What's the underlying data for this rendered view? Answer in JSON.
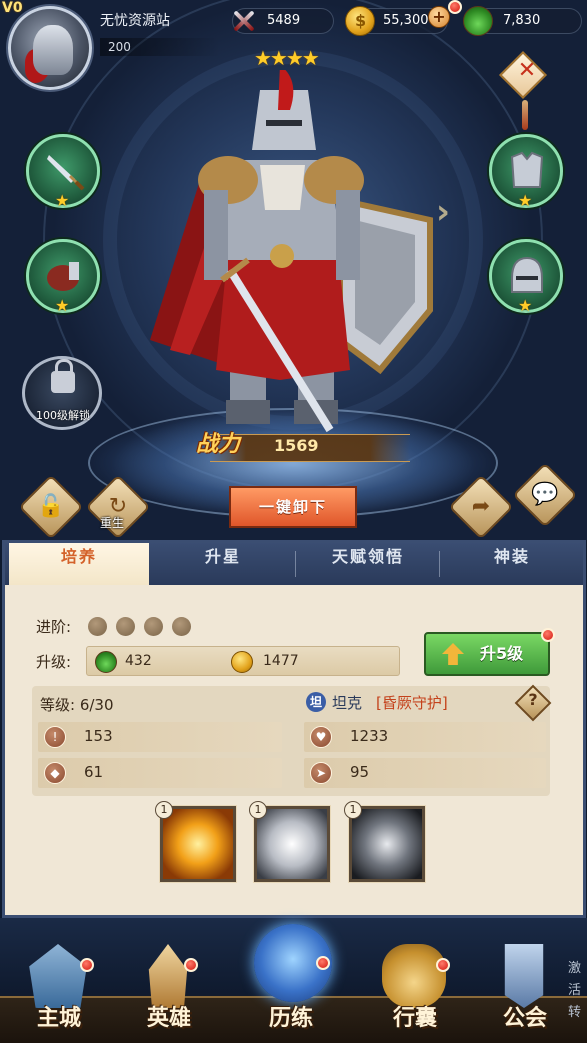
{
  "player": {
    "vip": "V0",
    "name": "无忧资源站",
    "level": "200"
  },
  "resources": {
    "power": "5489",
    "gold": "55,300",
    "potion": "7,830"
  },
  "hero": {
    "stars": "★★★★",
    "combat_label": "战力",
    "combat_value": "1569"
  },
  "equipment": {
    "weapon_star": "★",
    "glove_star": "★",
    "armor_star": "★",
    "helm_star": "★",
    "locked_slot_label": "100级解锁"
  },
  "actions": {
    "unequip_all": "一键卸下",
    "rebirth": "重生"
  },
  "tabs": [
    "培养",
    "升星",
    "天赋领悟",
    "神装"
  ],
  "panel": {
    "advance_label": "进阶:",
    "upgrade_label": "升级:",
    "cost_potion": "432",
    "cost_gold": "1477",
    "upgrade_button": "升5级",
    "level_label": "等级: 6/30",
    "class_badge": "坦",
    "class_name": "坦克",
    "class_trait": "[昏厥守护]",
    "help": "?",
    "stats": {
      "attack": "153",
      "hp": "1233",
      "defense": "61",
      "speed": "95"
    }
  },
  "skills": [
    {
      "level": "1"
    },
    {
      "level": "1"
    },
    {
      "level": "1"
    }
  ],
  "nav": [
    "主城",
    "英雄",
    "历练",
    "行囊",
    "公会"
  ],
  "side_hint": "激活转"
}
